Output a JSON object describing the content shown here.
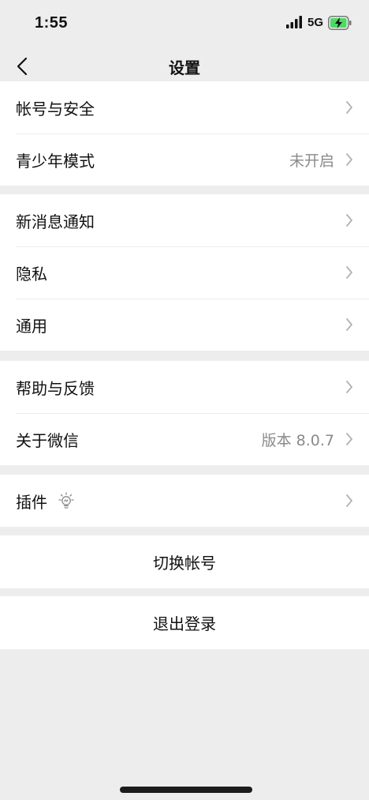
{
  "status_bar": {
    "time": "1:55",
    "network": "5G"
  },
  "nav": {
    "title": "设置"
  },
  "groups": {
    "account": {
      "security_label": "帐号与安全",
      "youth_label": "青少年模式",
      "youth_value": "未开启"
    },
    "general": {
      "notify_label": "新消息通知",
      "privacy_label": "隐私",
      "general_label": "通用"
    },
    "about": {
      "help_label": "帮助与反馈",
      "about_label": "关于微信",
      "version_value": "版本 8.0.7"
    },
    "plugins": {
      "plugins_label": "插件"
    }
  },
  "actions": {
    "switch_account": "切换帐号",
    "logout": "退出登录"
  },
  "icons": {
    "back": "chevron-left-icon",
    "row_arrow": "chevron-right-icon",
    "plugins": "lightbulb-icon",
    "signal": "signal-bars-icon",
    "battery": "battery-charging-icon"
  },
  "colors": {
    "background": "#ededed",
    "cell": "#ffffff",
    "secondary_text": "#8a8a8a",
    "battery_fill": "#4cd964"
  }
}
